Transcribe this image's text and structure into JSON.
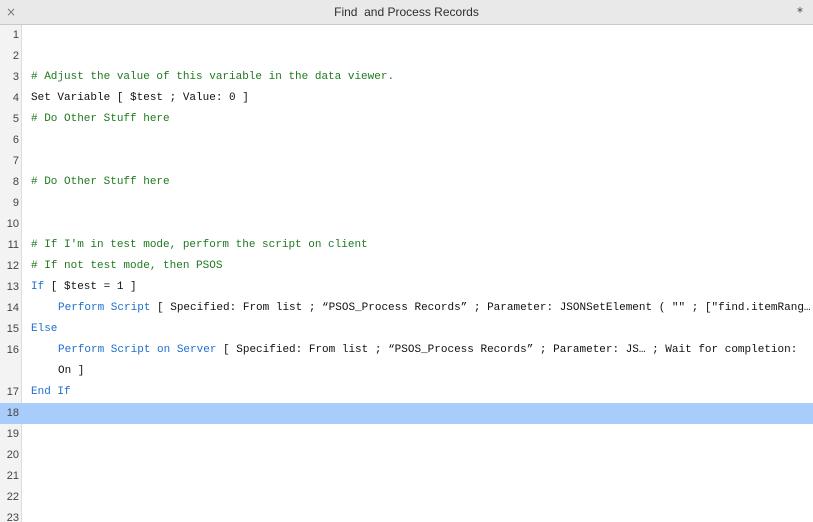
{
  "window": {
    "title": "Find  and Process Records",
    "close_glyph": "×",
    "modified_glyph": "*"
  },
  "lines": [
    {
      "num": "1",
      "text": ""
    },
    {
      "num": "2",
      "text": ""
    },
    {
      "num": "3",
      "text": "# Adjust the value of this variable in the data viewer."
    },
    {
      "num": "4",
      "text": "Set Variable [ $test ; Value: 0 ]"
    },
    {
      "num": "5",
      "text": "# Do Other Stuff here"
    },
    {
      "num": "6",
      "text": ""
    },
    {
      "num": "7",
      "text": ""
    },
    {
      "num": "8",
      "text": "# Do Other Stuff here"
    },
    {
      "num": "9",
      "text": ""
    },
    {
      "num": "10",
      "text": ""
    },
    {
      "num": "11",
      "text": "# If I'm in test mode, perform the script on client"
    },
    {
      "num": "12",
      "text": "# If not test mode, then PSOS"
    },
    {
      "num": "13",
      "kw": "If",
      "rest": " [ $test = 1 ]"
    },
    {
      "num": "14",
      "kw": "Perform Script",
      "rest": " [ Specified: From list ; “PSOS_Process Records” ; Parameter: JSONSetElement ( \"\" ; [\"find.itemRang… ]"
    },
    {
      "num": "15",
      "kw": "Else"
    },
    {
      "num": "16",
      "kw": "Perform Script on Server",
      "rest": " [ Specified: From list ; “PSOS_Process Records” ; Parameter: JS… ; Wait for completion:",
      "wrap": "On ]"
    },
    {
      "num": "17",
      "kw": "End If"
    },
    {
      "num": "18",
      "text": ""
    },
    {
      "num": "19",
      "text": ""
    },
    {
      "num": "20",
      "text": ""
    },
    {
      "num": "21",
      "text": ""
    },
    {
      "num": "22",
      "text": ""
    },
    {
      "num": "23",
      "text": ""
    }
  ]
}
